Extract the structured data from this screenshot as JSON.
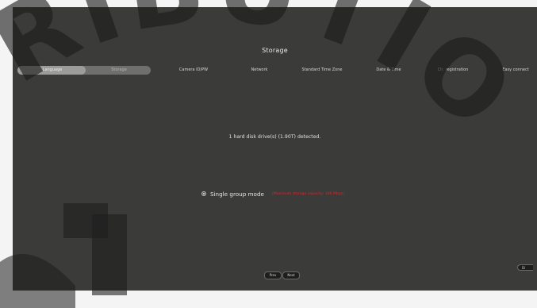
{
  "wizard": {
    "title": "Storage",
    "steps": [
      {
        "label": "Language",
        "state": "done"
      },
      {
        "label": "Storage",
        "state": "current"
      },
      {
        "label": "Camera ID/PW",
        "state": "pending"
      },
      {
        "label": "Network",
        "state": "pending"
      },
      {
        "label": "Standard Time Zone",
        "state": "pending"
      },
      {
        "label": "Date & Time",
        "state": "pending"
      },
      {
        "label": "Ch. registration",
        "state": "pending"
      },
      {
        "label": "Easy connect",
        "state": "pending"
      }
    ]
  },
  "storage": {
    "detected_message": "1 hard disk drive(s) (1.90T) detected.",
    "mode_label": "Single group mode",
    "mode_warning": "(Maximum storage capacity: 190 Mbps)",
    "mode_selected": true
  },
  "footer": {
    "prev_label": "Prev",
    "next_label": "Next",
    "corner_label": "Di"
  },
  "colors": {
    "screen_bg": "#3b3b39",
    "pill_done": "#9c9c99",
    "pill_track": "#6f6f6d",
    "warning": "#d9262b",
    "watermark": "#1c1c1c"
  },
  "watermark": {
    "text": "RIBUTIO"
  }
}
